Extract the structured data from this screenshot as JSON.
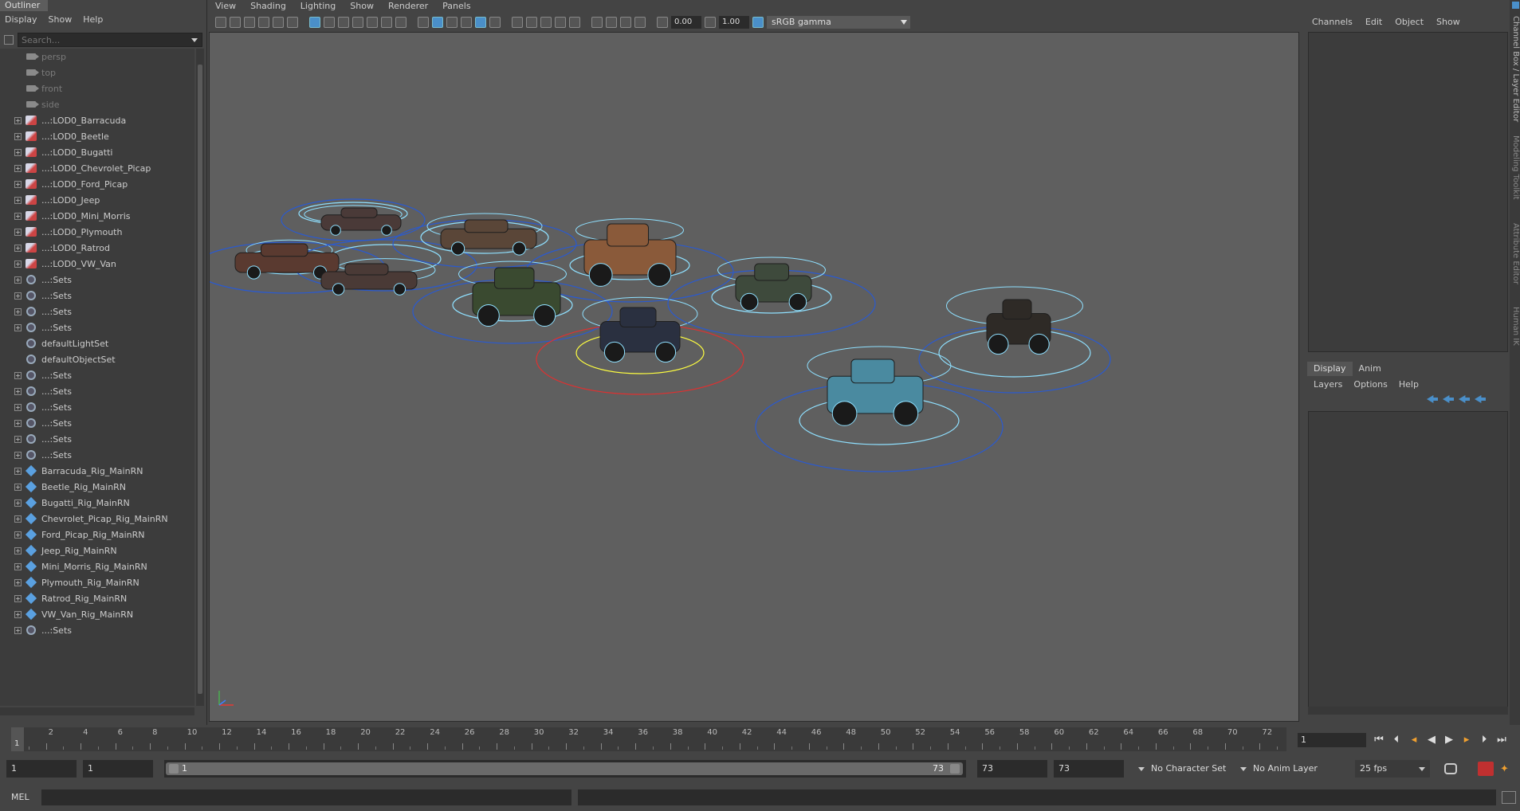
{
  "outliner": {
    "title": "Outliner",
    "menu": [
      "Display",
      "Show",
      "Help"
    ],
    "search_placeholder": "Search...",
    "items": [
      {
        "label": "persp",
        "type": "cam",
        "expand": false
      },
      {
        "label": "top",
        "type": "cam",
        "expand": false
      },
      {
        "label": "front",
        "type": "cam",
        "expand": false
      },
      {
        "label": "side",
        "type": "cam",
        "expand": false
      },
      {
        "label": "...:LOD0_Barracuda",
        "type": "lod",
        "expand": true
      },
      {
        "label": "...:LOD0_Beetle",
        "type": "lod",
        "expand": true
      },
      {
        "label": "...:LOD0_Bugatti",
        "type": "lod",
        "expand": true
      },
      {
        "label": "...:LOD0_Chevrolet_Picap",
        "type": "lod",
        "expand": true
      },
      {
        "label": "...:LOD0_Ford_Picap",
        "type": "lod",
        "expand": true
      },
      {
        "label": "...:LOD0_Jeep",
        "type": "lod",
        "expand": true
      },
      {
        "label": "...:LOD0_Mini_Morris",
        "type": "lod",
        "expand": true
      },
      {
        "label": "...:LOD0_Plymouth",
        "type": "lod",
        "expand": true
      },
      {
        "label": "...:LOD0_Ratrod",
        "type": "lod",
        "expand": true
      },
      {
        "label": "...:LOD0_VW_Van",
        "type": "lod",
        "expand": true
      },
      {
        "label": "...:Sets",
        "type": "set",
        "expand": true
      },
      {
        "label": "...:Sets",
        "type": "set",
        "expand": true
      },
      {
        "label": "...:Sets",
        "type": "set",
        "expand": true
      },
      {
        "label": "...:Sets",
        "type": "set",
        "expand": true
      },
      {
        "label": "defaultLightSet",
        "type": "set",
        "expand": false
      },
      {
        "label": "defaultObjectSet",
        "type": "set",
        "expand": false
      },
      {
        "label": "...:Sets",
        "type": "set",
        "expand": true
      },
      {
        "label": "...:Sets",
        "type": "set",
        "expand": true
      },
      {
        "label": "...:Sets",
        "type": "set",
        "expand": true
      },
      {
        "label": "...:Sets",
        "type": "set",
        "expand": true
      },
      {
        "label": "...:Sets",
        "type": "set",
        "expand": true
      },
      {
        "label": "...:Sets",
        "type": "set",
        "expand": true
      },
      {
        "label": "Barracuda_Rig_MainRN",
        "type": "rig",
        "expand": true
      },
      {
        "label": "Beetle_Rig_MainRN",
        "type": "rig",
        "expand": true
      },
      {
        "label": "Bugatti_Rig_MainRN",
        "type": "rig",
        "expand": true
      },
      {
        "label": "Chevrolet_Picap_Rig_MainRN",
        "type": "rig",
        "expand": true
      },
      {
        "label": "Ford_Picap_Rig_MainRN",
        "type": "rig",
        "expand": true
      },
      {
        "label": "Jeep_Rig_MainRN",
        "type": "rig",
        "expand": true
      },
      {
        "label": "Mini_Morris_Rig_MainRN",
        "type": "rig",
        "expand": true
      },
      {
        "label": "Plymouth_Rig_MainRN",
        "type": "rig",
        "expand": true
      },
      {
        "label": "Ratrod_Rig_MainRN",
        "type": "rig",
        "expand": true
      },
      {
        "label": "VW_Van_Rig_MainRN",
        "type": "rig",
        "expand": true
      },
      {
        "label": "...:Sets",
        "type": "set",
        "expand": true
      }
    ]
  },
  "viewport": {
    "menu": [
      "View",
      "Shading",
      "Lighting",
      "Show",
      "Renderer",
      "Panels"
    ],
    "exposure": "0.00",
    "gamma": "1.00",
    "color_space": "sRGB gamma"
  },
  "channel_box": {
    "menu": [
      "Channels",
      "Edit",
      "Object",
      "Show"
    ]
  },
  "side_tabs": [
    "Channel Box / Layer Editor",
    "Modeling Toolkit",
    "Attribute Editor",
    "Human IK"
  ],
  "layer_editor": {
    "tabs": [
      "Display",
      "Anim"
    ],
    "active_tab": "Display",
    "menu": [
      "Layers",
      "Options",
      "Help"
    ]
  },
  "timeline": {
    "ticks": [
      "2",
      "4",
      "6",
      "8",
      "10",
      "12",
      "14",
      "16",
      "18",
      "20",
      "22",
      "24",
      "26",
      "28",
      "30",
      "32",
      "34",
      "36",
      "38",
      "40",
      "42",
      "44",
      "46",
      "48",
      "50",
      "52",
      "54",
      "56",
      "58",
      "60",
      "62",
      "64",
      "66",
      "68",
      "70",
      "72"
    ],
    "current_marker": "1",
    "current_frame": "1"
  },
  "range": {
    "start": "1",
    "inner_start": "1",
    "slider_start": "1",
    "slider_end": "73",
    "inner_end": "73",
    "end": "73",
    "character_set": "No Character Set",
    "anim_layer": "No Anim Layer",
    "fps": "25 fps"
  },
  "command_line": {
    "label": "MEL"
  },
  "colors": {
    "accent": "#4a8fc9",
    "selected_ring": "#ffff40",
    "selected_outer": "#e03030",
    "ring": "#8fe0ff",
    "outer_ring": "#2a5ad0"
  }
}
